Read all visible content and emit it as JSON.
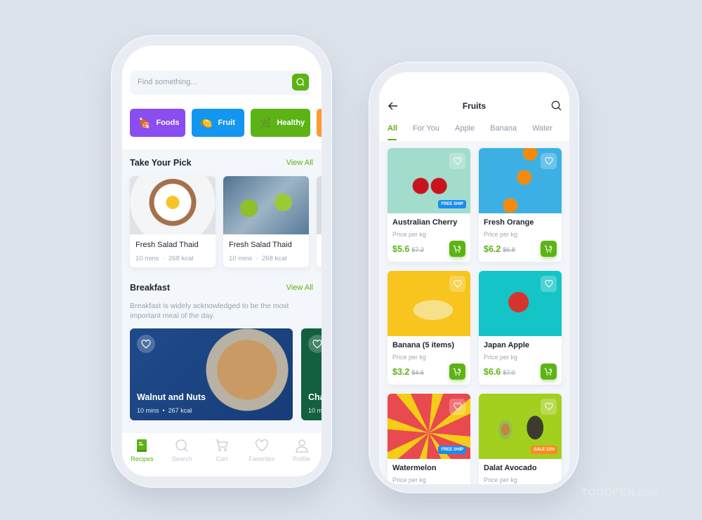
{
  "left_app": {
    "search": {
      "placeholder": "Find something...",
      "icon": "search-icon"
    },
    "categories": [
      {
        "label": "Foods",
        "icon": "meat-icon",
        "color": "#8a4df0"
      },
      {
        "label": "Fruit",
        "icon": "lemon-icon",
        "color": "#1296f0"
      },
      {
        "label": "Healthy",
        "icon": "herb-icon",
        "color": "#5cb315"
      },
      {
        "label": "",
        "icon": "",
        "color": "#ff9a2e"
      }
    ],
    "take_your_pick": {
      "title": "Take Your Pick",
      "view_all": "View All",
      "items": [
        {
          "title": "Fresh Salad Thaid",
          "time": "10 mins",
          "kcal": "268 kcal"
        },
        {
          "title": "Fresh Salad Thaid",
          "time": "10 mins",
          "kcal": "268 kcal"
        }
      ]
    },
    "breakfast": {
      "title": "Breakfast",
      "view_all": "View All",
      "description": "Breakfast is widely acknowledged to be the most important meal of the day.",
      "items": [
        {
          "title": "Walnut and Nuts",
          "time": "10 mins",
          "kcal": "267 kcal"
        },
        {
          "title": "Cha",
          "time": "10 m",
          "kcal": ""
        }
      ]
    },
    "tabbar": [
      {
        "label": "Recipes",
        "icon": "book-icon",
        "active": true
      },
      {
        "label": "Search",
        "icon": "search-icon",
        "active": false
      },
      {
        "label": "Cart",
        "icon": "cart-icon",
        "active": false
      },
      {
        "label": "Favorites",
        "icon": "heart-icon",
        "active": false
      },
      {
        "label": "Profile",
        "icon": "user-icon",
        "active": false
      }
    ]
  },
  "right_app": {
    "title": "Fruits",
    "tabs": [
      "All",
      "For You",
      "Apple",
      "Banana",
      "Water"
    ],
    "active_tab": "All",
    "products": [
      {
        "name": "Australian Cherry",
        "unit": "Price per kg",
        "price": "$5.6",
        "old_price": "$7.2",
        "badge": "FREE SHIP"
      },
      {
        "name": "Fresh Orange",
        "unit": "Price per kg",
        "price": "$6.2",
        "old_price": "$6.8",
        "badge": ""
      },
      {
        "name": "Banana (5 items)",
        "unit": "Price per kg",
        "price": "$3.2",
        "old_price": "$4.6",
        "badge": ""
      },
      {
        "name": "Japan Apple",
        "unit": "Price per kg",
        "price": "$6.6",
        "old_price": "$7.0",
        "badge": ""
      },
      {
        "name": "Watermelon",
        "unit": "Price per kg",
        "price": "",
        "old_price": "",
        "badge": "FREE SHIP"
      },
      {
        "name": "Dalat Avocado",
        "unit": "Price per kg",
        "price": "",
        "old_price": "",
        "badge": "SALE 12%"
      }
    ]
  },
  "colors": {
    "accent": "#5cb315",
    "badge_blue": "#1a8cf0",
    "badge_orange": "#ff8a1f"
  },
  "watermark": "TOOOPEN.com"
}
